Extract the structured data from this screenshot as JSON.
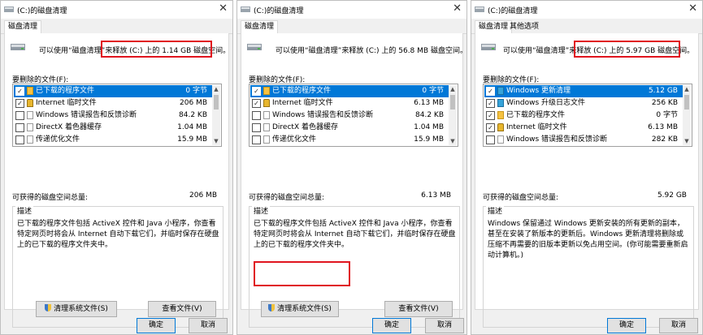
{
  "panels": [
    {
      "title": "(C:)的磁盘清理",
      "tabs": [
        "磁盘清理"
      ],
      "intro": "可以使用“磁盘清理”来释放 (C:) 上的 1.14 GB 磁盘空间。",
      "files_label": "要删除的文件(F):",
      "files": [
        {
          "name": "已下载的程序文件",
          "size": "0 字节",
          "checked": true,
          "selected": true,
          "icon": "folder-icon"
        },
        {
          "name": "Internet 临时文件",
          "size": "206 MB",
          "checked": true,
          "selected": false,
          "icon": "lock-icon"
        },
        {
          "name": "Windows 错误报告和反馈诊断",
          "size": "84.2 KB",
          "checked": false,
          "selected": false,
          "icon": "document-icon"
        },
        {
          "name": "DirectX 着色器缓存",
          "size": "1.04 MB",
          "checked": false,
          "selected": false,
          "icon": "document-icon"
        },
        {
          "name": "传递优化文件",
          "size": "15.9 MB",
          "checked": false,
          "selected": false,
          "icon": "document-icon"
        }
      ],
      "total_label": "可获得的磁盘空间总量:",
      "total_value": "206 MB",
      "description_title": "描述",
      "description": "已下载的程序文件包括 ActiveX 控件和 Java 小程序，你查看特定网页时将会从 Internet 自动下载它们，并临时保存在硬盘上的已下载的程序文件夹中。",
      "cleanup_system_button": "清理系统文件(S)",
      "view_files_button": "查看文件(V)",
      "ok_button": "确定",
      "cancel_button": "取消"
    },
    {
      "title": "(C:)的磁盘清理",
      "tabs": [
        "磁盘清理"
      ],
      "intro": "可以使用“磁盘清理”来释放 (C:) 上的 56.8 MB 磁盘空间。",
      "files_label": "要删除的文件(F):",
      "files": [
        {
          "name": "已下载的程序文件",
          "size": "0 字节",
          "checked": true,
          "selected": true,
          "icon": "folder-icon"
        },
        {
          "name": "Internet 临时文件",
          "size": "6.13 MB",
          "checked": true,
          "selected": false,
          "icon": "lock-icon"
        },
        {
          "name": "Windows 错误报告和反馈诊断",
          "size": "84.2 KB",
          "checked": false,
          "selected": false,
          "icon": "document-icon"
        },
        {
          "name": "DirectX 着色器缓存",
          "size": "1.04 MB",
          "checked": false,
          "selected": false,
          "icon": "document-icon"
        },
        {
          "name": "传递优化文件",
          "size": "15.9 MB",
          "checked": false,
          "selected": false,
          "icon": "document-icon"
        }
      ],
      "total_label": "可获得的磁盘空间总量:",
      "total_value": "6.13 MB",
      "description_title": "描述",
      "description": "已下载的程序文件包括 ActiveX 控件和 Java 小程序，你查看特定网页时将会从 Internet 自动下载它们，并临时保存在硬盘上的已下载的程序文件夹中。",
      "cleanup_system_button": "清理系统文件(S)",
      "view_files_button": "查看文件(V)",
      "ok_button": "确定",
      "cancel_button": "取消"
    },
    {
      "title": "(C:)的磁盘清理",
      "tabs": [
        "磁盘清理",
        "其他选项"
      ],
      "intro": "可以使用“磁盘清理”来释放 (C:) 上的 5.97 GB 磁盘空间。",
      "files_label": "要删除的文件(F):",
      "files": [
        {
          "name": "Windows 更新清理",
          "size": "5.12 GB",
          "checked": true,
          "selected": true,
          "icon": "windows-icon"
        },
        {
          "name": "Windows 升级日志文件",
          "size": "256 KB",
          "checked": true,
          "selected": false,
          "icon": "windows-icon"
        },
        {
          "name": "已下载的程序文件",
          "size": "0 字节",
          "checked": true,
          "selected": false,
          "icon": "folder-icon"
        },
        {
          "name": "Internet 临时文件",
          "size": "6.13 MB",
          "checked": true,
          "selected": false,
          "icon": "lock-icon"
        },
        {
          "name": "Windows 错误报告和反馈诊断",
          "size": "282 KB",
          "checked": false,
          "selected": false,
          "icon": "document-icon"
        }
      ],
      "total_label": "可获得的磁盘空间总量:",
      "total_value": "5.92 GB",
      "description_title": "描述",
      "description": "Windows 保留通过 Windows 更新安装的所有更新的副本，甚至在安装了新版本的更新后。Windows 更新清理将删除或压缩不再需要的旧版本更新以免占用空间。(你可能需要重新启动计算机。)",
      "ok_button": "确定",
      "cancel_button": "取消"
    }
  ],
  "colors": {
    "selection": "#0078d7",
    "highlight_box": "#e0141e"
  }
}
